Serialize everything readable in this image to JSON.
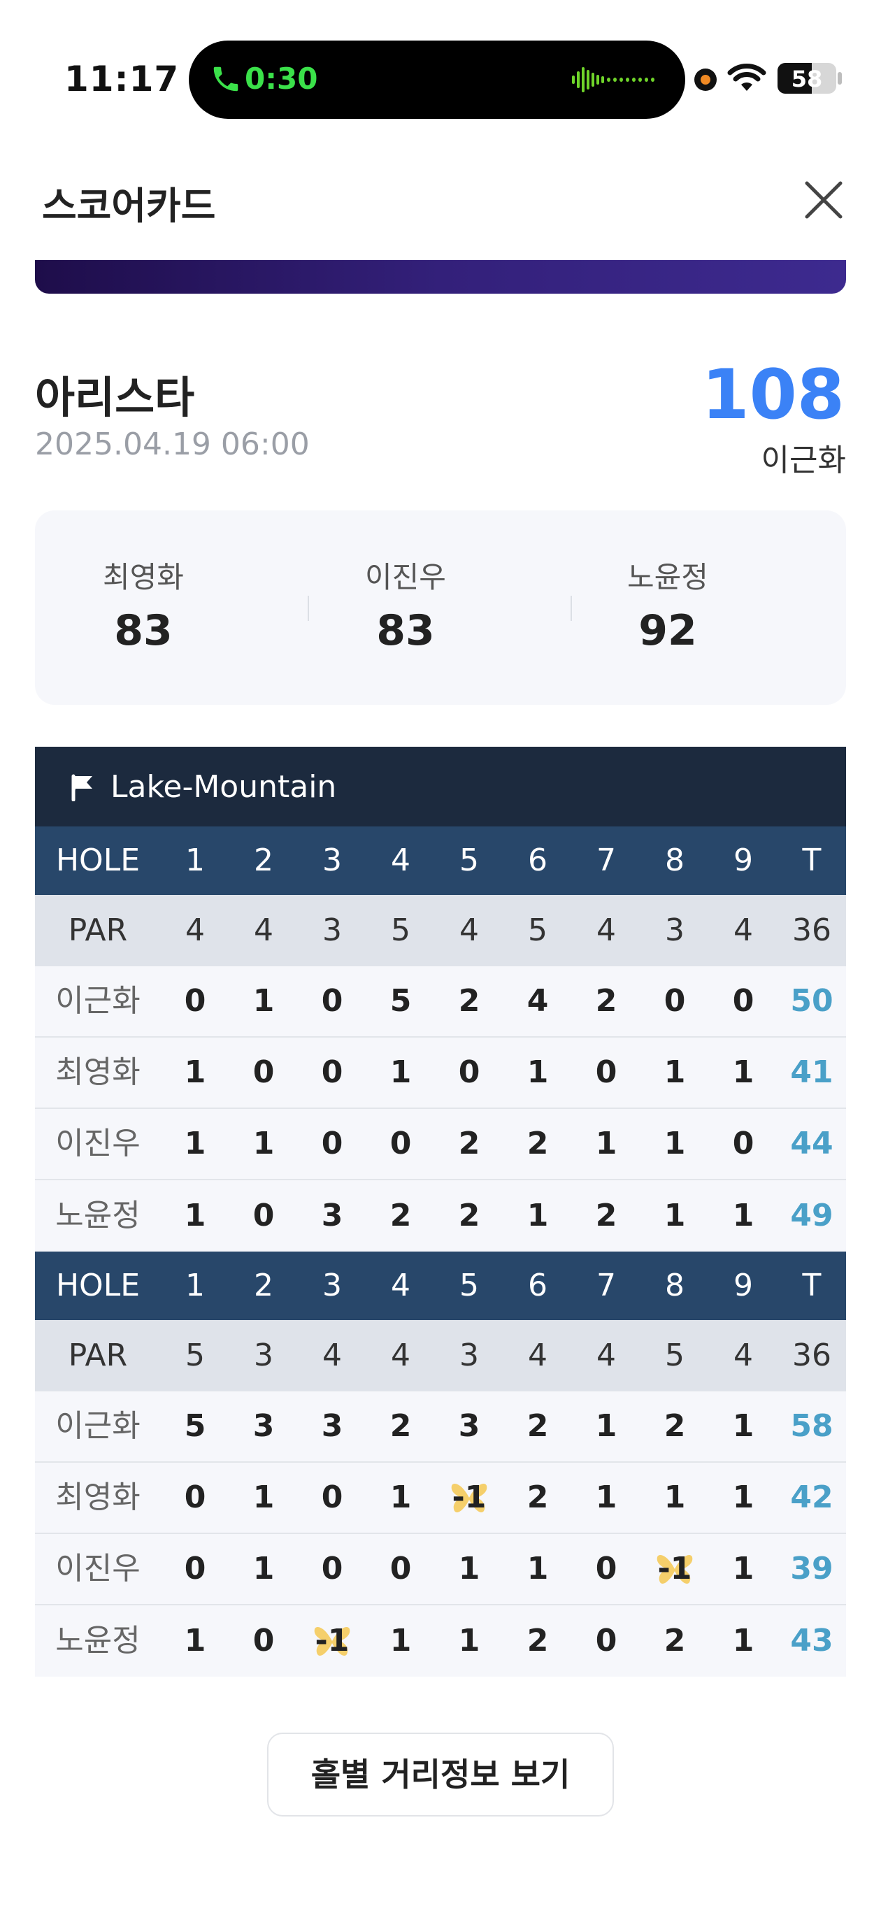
{
  "status_bar": {
    "time": "11:17",
    "call_timer": "0:30",
    "battery_level": "58",
    "battery_fraction": 0.58
  },
  "header": {
    "title": "스코어카드",
    "close_icon": "close-icon"
  },
  "round": {
    "course_name": "아리스타",
    "datetime": "2025.04.19 06:00",
    "my_score": "108",
    "my_name": "이근화"
  },
  "companions": [
    {
      "name": "최영화",
      "score": "83"
    },
    {
      "name": "이진우",
      "score": "83"
    },
    {
      "name": "노윤정",
      "score": "92"
    }
  ],
  "scorecard": {
    "course": "Lake-Mountain",
    "hole_label": "HOLE",
    "par_label": "PAR",
    "total_label": "T",
    "colors": {
      "course_bar": "#1c2a3e",
      "hole_row": "#28476a",
      "par_row": "#dfe3ea",
      "total_text": "#4aa0c8",
      "birdie_marker": "#f5cf6b"
    },
    "halves": [
      {
        "holes": [
          "1",
          "2",
          "3",
          "4",
          "5",
          "6",
          "7",
          "8",
          "9"
        ],
        "par": [
          "4",
          "4",
          "3",
          "5",
          "4",
          "5",
          "4",
          "3",
          "4"
        ],
        "par_total": "36",
        "players": [
          {
            "name": "이근화",
            "scores": [
              "0",
              "1",
              "0",
              "5",
              "2",
              "4",
              "2",
              "0",
              "0"
            ],
            "total": "50"
          },
          {
            "name": "최영화",
            "scores": [
              "1",
              "0",
              "0",
              "1",
              "0",
              "1",
              "0",
              "1",
              "1"
            ],
            "total": "41"
          },
          {
            "name": "이진우",
            "scores": [
              "1",
              "1",
              "0",
              "0",
              "2",
              "2",
              "1",
              "1",
              "0"
            ],
            "total": "44"
          },
          {
            "name": "노윤정",
            "scores": [
              "1",
              "0",
              "3",
              "2",
              "2",
              "1",
              "2",
              "1",
              "1"
            ],
            "total": "49"
          }
        ]
      },
      {
        "holes": [
          "1",
          "2",
          "3",
          "4",
          "5",
          "6",
          "7",
          "8",
          "9"
        ],
        "par": [
          "5",
          "3",
          "4",
          "4",
          "3",
          "4",
          "4",
          "5",
          "4"
        ],
        "par_total": "36",
        "players": [
          {
            "name": "이근화",
            "scores": [
              "5",
              "3",
              "3",
              "2",
              "3",
              "2",
              "1",
              "2",
              "1"
            ],
            "total": "58"
          },
          {
            "name": "최영화",
            "scores": [
              "0",
              "1",
              "0",
              "1",
              "-1",
              "2",
              "1",
              "1",
              "1"
            ],
            "total": "42"
          },
          {
            "name": "이진우",
            "scores": [
              "0",
              "1",
              "0",
              "0",
              "1",
              "1",
              "0",
              "-1",
              "1"
            ],
            "total": "39"
          },
          {
            "name": "노윤정",
            "scores": [
              "1",
              "0",
              "-1",
              "1",
              "1",
              "2",
              "0",
              "2",
              "1"
            ],
            "total": "43"
          }
        ]
      }
    ]
  },
  "footer": {
    "distance_button_label": "홀별 거리정보 보기"
  }
}
